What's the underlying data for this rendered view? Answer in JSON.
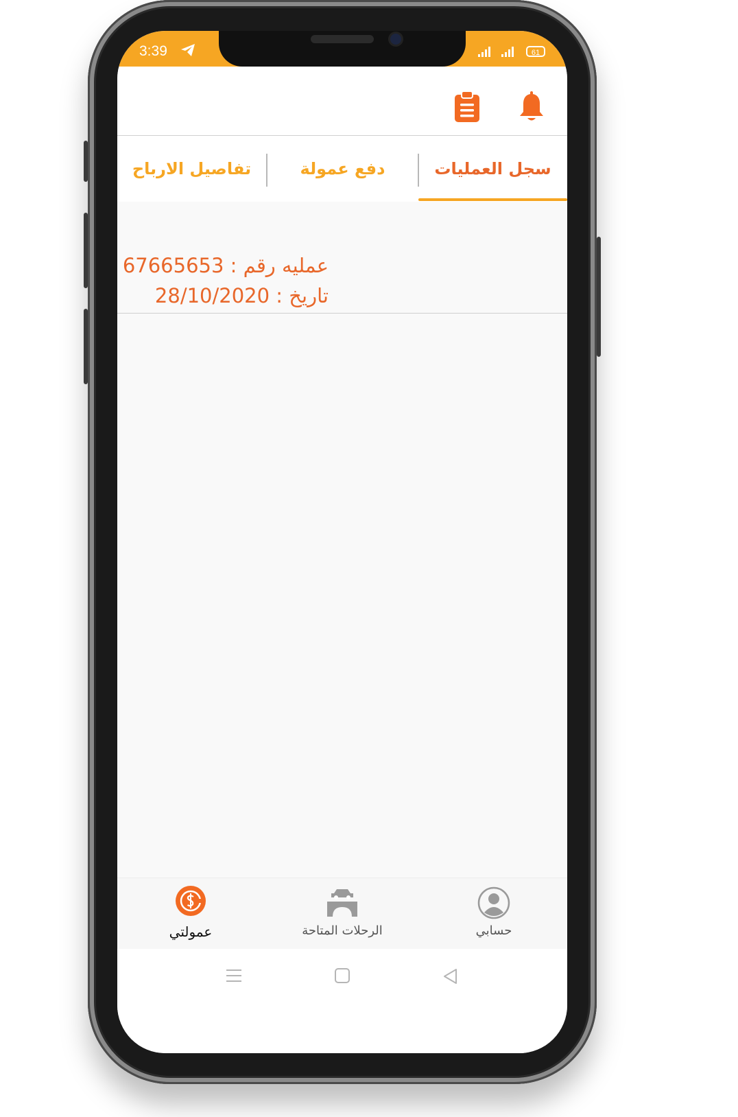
{
  "status_bar": {
    "time": "3:39",
    "battery": "61"
  },
  "header": {
    "bell_icon": "bell-icon",
    "clipboard_icon": "clipboard-icon"
  },
  "tabs": [
    {
      "label": "سجل العمليات",
      "active": true
    },
    {
      "label": "دفع عمولة",
      "active": false
    },
    {
      "label": "تفاصيل الارباح",
      "active": false
    }
  ],
  "records": [
    {
      "operation_line": "عمليه رقم : 67665653",
      "date_line": "تاريخ : 28/10/2020"
    }
  ],
  "bottom_nav": [
    {
      "label": "عمولتي",
      "icon": "commission-dollar-icon",
      "active": true
    },
    {
      "label": "الرحلات المتاحة",
      "icon": "car-bridge-icon",
      "active": false
    },
    {
      "label": "حسابي",
      "icon": "user-avatar-icon",
      "active": false
    }
  ],
  "system_nav": {
    "menu_icon": "menu-lines-icon",
    "home_icon": "square-home-icon",
    "back_icon": "triangle-back-icon"
  },
  "colors": {
    "accent_orange": "#f6a623",
    "active_orange": "#e8672a"
  }
}
